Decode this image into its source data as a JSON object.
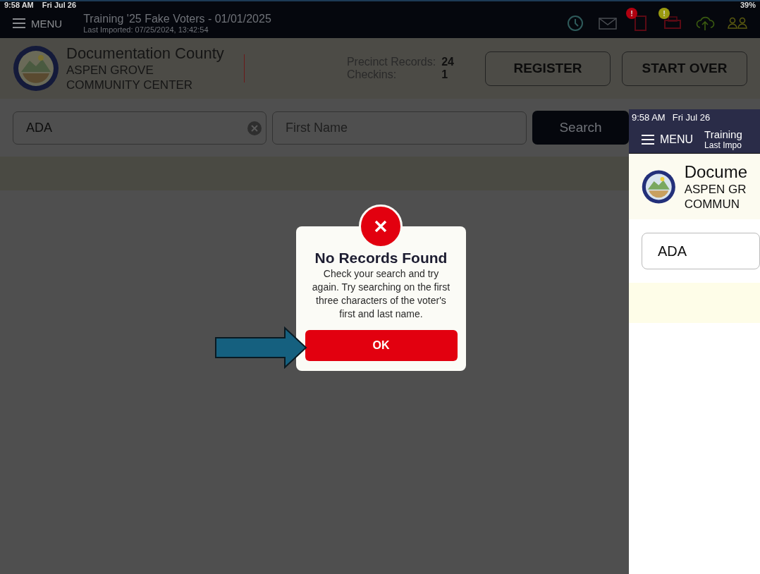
{
  "status_bar": {
    "time": "9:58 AM",
    "date": "Fri Jul 26",
    "battery": "39%"
  },
  "header": {
    "menu_label": "MENU",
    "title": "Training '25 Fake Voters - 01/01/2025",
    "subtitle": "Last Imported: 07/25/2024, 13:42:54",
    "badges": [
      {
        "text": "!",
        "color": "#b00010"
      },
      {
        "text": "!",
        "color": "#9a9a10"
      }
    ]
  },
  "location": {
    "county": "Documentation County",
    "site_lines": [
      "ASPEN GROVE",
      "COMMUNITY CENTER"
    ]
  },
  "stats": [
    {
      "label": "Precinct Records:",
      "value": "24"
    },
    {
      "label": "Checkins:",
      "value": "1"
    }
  ],
  "buttons": [
    "REGISTER",
    "START OVER"
  ],
  "search": {
    "last_name": "ADA",
    "first_name_placeholder": "First Name",
    "button": "Search"
  },
  "dialog": {
    "title": "No Records Found",
    "message": "Check your search and try again. Try searching on the first three characters of the voter's first and last name.",
    "button": "OK"
  },
  "side_preview": {
    "time": "9:58 AM",
    "date": "Fri Jul 26",
    "menu_label": "MENU",
    "title": "Training",
    "subtitle": "Last Impo",
    "county": "Docume",
    "site_lines": [
      "ASPEN GR",
      "COMMUN"
    ],
    "search_value": "ADA"
  }
}
